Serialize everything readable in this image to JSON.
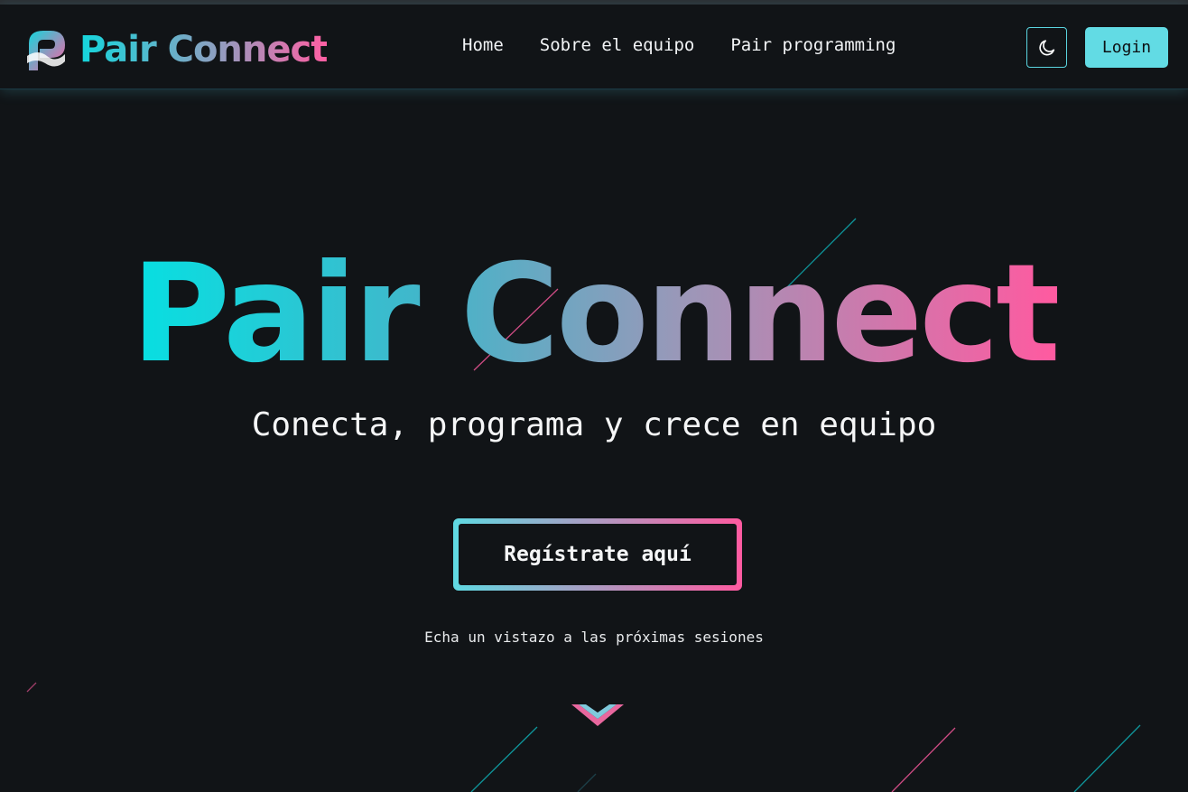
{
  "brand": {
    "name": "Pair Connect",
    "logo_icon": "pair-connect-logo-icon"
  },
  "nav": {
    "links": [
      {
        "label": "Home"
      },
      {
        "label": "Sobre el equipo"
      },
      {
        "label": "Pair programming"
      }
    ],
    "theme_toggle_icon": "moon-icon",
    "login_label": "Login"
  },
  "hero": {
    "title": "Pair Connect",
    "subtitle": "Conecta, programa y crece en equipo",
    "cta_label": "Regístrate aquí",
    "hint": "Echa un vistazo a las próximas sesiones",
    "scroll_icon": "chevron-down-icon"
  },
  "colors": {
    "background": "#111417",
    "accent_cyan": "#62dbe4",
    "gradient_start": "#06e0e2",
    "gradient_end": "#ff5aa0"
  }
}
